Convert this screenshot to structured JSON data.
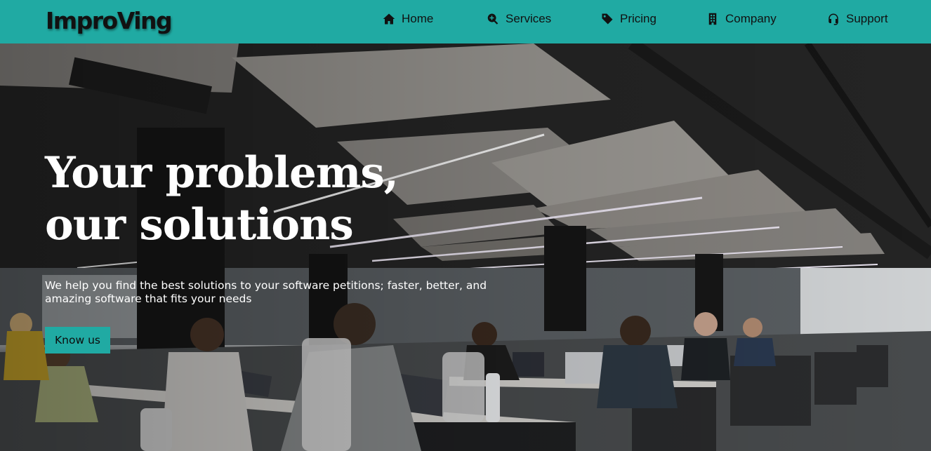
{
  "header": {
    "brand": "ImproVing",
    "nav": [
      {
        "label": "Home",
        "icon": "home-icon"
      },
      {
        "label": "Services",
        "icon": "search-plus-icon"
      },
      {
        "label": "Pricing",
        "icon": "tag-icon"
      },
      {
        "label": "Company",
        "icon": "building-icon"
      },
      {
        "label": "Support",
        "icon": "headset-icon"
      }
    ]
  },
  "hero": {
    "headline_line1": "Your problems,",
    "headline_line2": "our solutions",
    "subtext": "We help you find the best solutions to your software petitions; faster, better, and amazing software that fits your needs",
    "cta_label": "Know us",
    "image": "open-plan-office-photo"
  },
  "colors": {
    "accent": "#20aaa3",
    "text_dark": "#111111",
    "text_light": "#ffffff"
  }
}
